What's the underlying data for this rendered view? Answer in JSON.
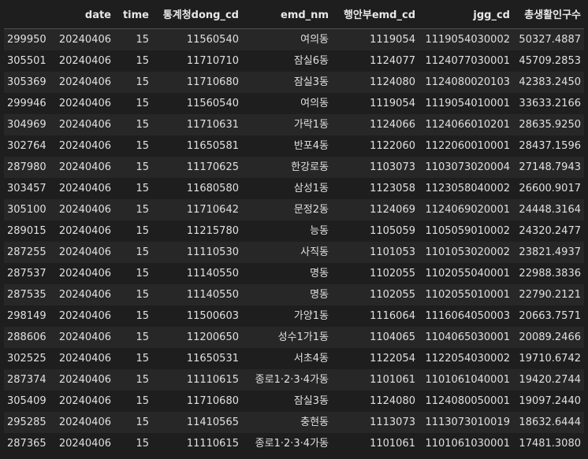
{
  "table": {
    "columns": [
      "",
      "date",
      "time",
      "통계청dong_cd",
      "emd_nm",
      "행안부emd_cd",
      "jgg_cd",
      "총생활인구수"
    ],
    "rows": [
      [
        "299950",
        "20240406",
        "15",
        "11560540",
        "여의동",
        "1119054",
        "1119054030002",
        "50327.4887"
      ],
      [
        "305501",
        "20240406",
        "15",
        "11710710",
        "잠실6동",
        "1124077",
        "1124077030001",
        "45709.2853"
      ],
      [
        "305369",
        "20240406",
        "15",
        "11710680",
        "잠실3동",
        "1124080",
        "1124080020103",
        "42383.2450"
      ],
      [
        "299946",
        "20240406",
        "15",
        "11560540",
        "여의동",
        "1119054",
        "1119054010001",
        "33633.2166"
      ],
      [
        "304969",
        "20240406",
        "15",
        "11710631",
        "가락1동",
        "1124066",
        "1124066010201",
        "28635.9250"
      ],
      [
        "302764",
        "20240406",
        "15",
        "11650581",
        "반포4동",
        "1122060",
        "1122060010001",
        "28437.1596"
      ],
      [
        "287980",
        "20240406",
        "15",
        "11170625",
        "한강로동",
        "1103073",
        "1103073020004",
        "27148.7943"
      ],
      [
        "303457",
        "20240406",
        "15",
        "11680580",
        "삼성1동",
        "1123058",
        "1123058040002",
        "26600.9017"
      ],
      [
        "305100",
        "20240406",
        "15",
        "11710642",
        "문정2동",
        "1124069",
        "1124069020001",
        "24448.3164"
      ],
      [
        "289015",
        "20240406",
        "15",
        "11215780",
        "능동",
        "1105059",
        "1105059010002",
        "24320.2477"
      ],
      [
        "287255",
        "20240406",
        "15",
        "11110530",
        "사직동",
        "1101053",
        "1101053020002",
        "23821.4937"
      ],
      [
        "287537",
        "20240406",
        "15",
        "11140550",
        "명동",
        "1102055",
        "1102055040001",
        "22988.3836"
      ],
      [
        "287535",
        "20240406",
        "15",
        "11140550",
        "명동",
        "1102055",
        "1102055010001",
        "22790.2121"
      ],
      [
        "298149",
        "20240406",
        "15",
        "11500603",
        "가양1동",
        "1116064",
        "1116064050003",
        "20663.7571"
      ],
      [
        "288606",
        "20240406",
        "15",
        "11200650",
        "성수1가1동",
        "1104065",
        "1104065030001",
        "20089.2466"
      ],
      [
        "302525",
        "20240406",
        "15",
        "11650531",
        "서초4동",
        "1122054",
        "1122054030002",
        "19710.6742"
      ],
      [
        "287374",
        "20240406",
        "15",
        "11110615",
        "종로1·2·3·4가동",
        "1101061",
        "1101061040001",
        "19420.2744"
      ],
      [
        "305409",
        "20240406",
        "15",
        "11710680",
        "잠실3동",
        "1124080",
        "1124080050001",
        "19097.2440"
      ],
      [
        "295285",
        "20240406",
        "15",
        "11410565",
        "충현동",
        "1113073",
        "1113073010019",
        "18632.6444"
      ],
      [
        "287365",
        "20240406",
        "15",
        "11110615",
        "종로1·2·3·4가동",
        "1101061",
        "1101061030001",
        "17481.3080"
      ]
    ]
  }
}
